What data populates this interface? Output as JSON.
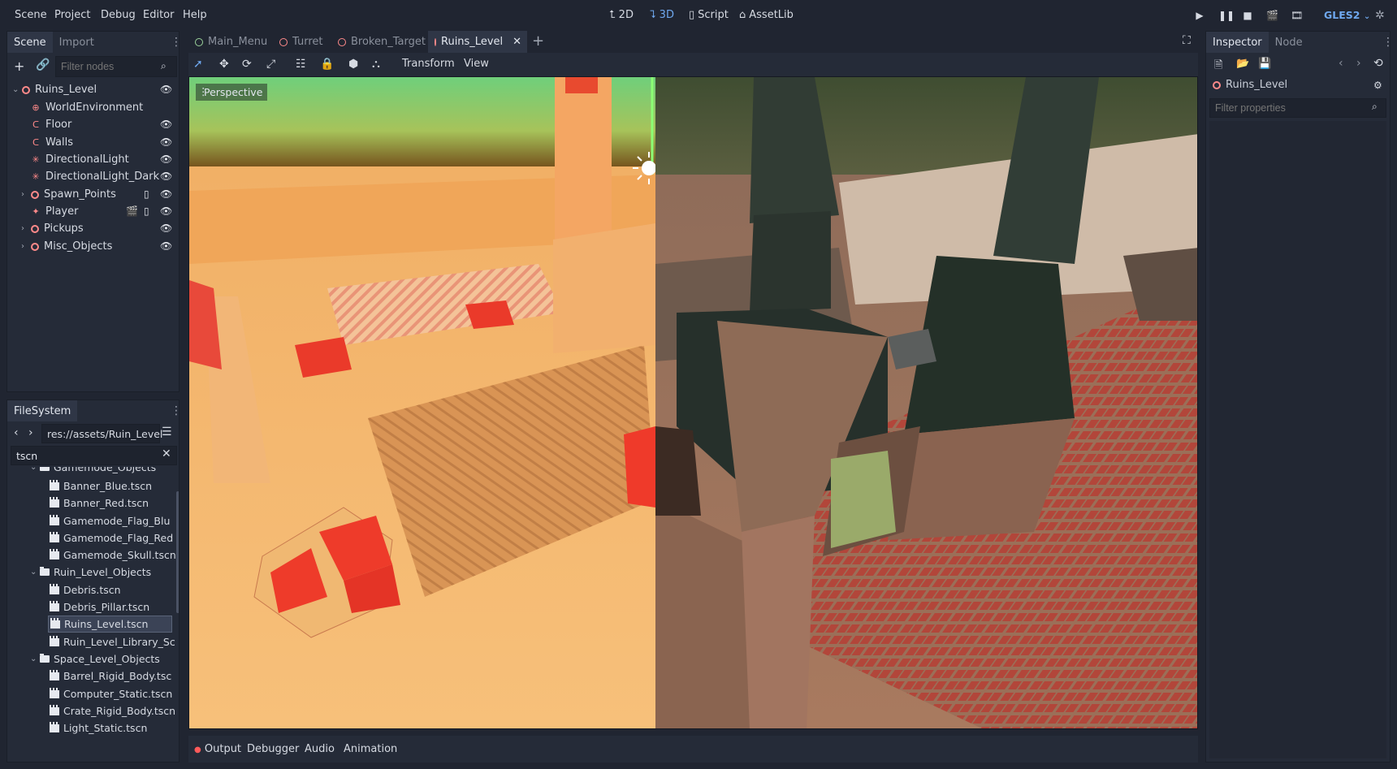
{
  "menu": [
    "Scene",
    "Project",
    "Debug",
    "Editor",
    "Help"
  ],
  "modes": {
    "2d": "2D",
    "3d": "3D",
    "script": "Script",
    "assetlib": "AssetLib"
  },
  "renderer": "GLES2",
  "left_top_panel": {
    "tabs": [
      "Scene",
      "Import"
    ],
    "filter_placeholder": "Filter nodes",
    "tree": [
      {
        "label": "Ruins_Level",
        "icon": "ring-icon"
      },
      {
        "label": "WorldEnvironment",
        "icon": "globe-icon"
      },
      {
        "label": "Floor",
        "icon": "magnet-icon"
      },
      {
        "label": "Walls",
        "icon": "magnet-icon"
      },
      {
        "label": "DirectionalLight",
        "icon": "sun-icon"
      },
      {
        "label": "DirectionalLight_Dark",
        "icon": "sun-icon"
      },
      {
        "label": "Spawn_Points",
        "icon": "ring-icon"
      },
      {
        "label": "Player",
        "icon": "character-icon"
      },
      {
        "label": "Pickups",
        "icon": "ring-icon"
      },
      {
        "label": "Misc_Objects",
        "icon": "ring-icon"
      }
    ]
  },
  "filesystem": {
    "tab": "FileSystem",
    "path": "res://assets/Ruin_Level",
    "search_value": "tscn",
    "items": [
      {
        "label": "Gamemode_Objects",
        "kind": "folder"
      },
      {
        "label": "Banner_Blue.tscn",
        "kind": "scene"
      },
      {
        "label": "Banner_Red.tscn",
        "kind": "scene"
      },
      {
        "label": "Gamemode_Flag_Blu",
        "kind": "scene"
      },
      {
        "label": "Gamemode_Flag_Red",
        "kind": "scene"
      },
      {
        "label": "Gamemode_Skull.tscn",
        "kind": "scene"
      },
      {
        "label": "Ruin_Level_Objects",
        "kind": "folder"
      },
      {
        "label": "Debris.tscn",
        "kind": "scene"
      },
      {
        "label": "Debris_Pillar.tscn",
        "kind": "scene"
      },
      {
        "label": "Ruins_Level.tscn",
        "kind": "scene"
      },
      {
        "label": "Ruin_Level_Library_Sc",
        "kind": "scene"
      },
      {
        "label": "Space_Level_Objects",
        "kind": "folder"
      },
      {
        "label": "Barrel_Rigid_Body.tsc",
        "kind": "scene"
      },
      {
        "label": "Computer_Static.tscn",
        "kind": "scene"
      },
      {
        "label": "Crate_Rigid_Body.tscn",
        "kind": "scene"
      },
      {
        "label": "Light_Static.tscn",
        "kind": "scene"
      }
    ]
  },
  "scene_tabs": [
    "Main_Menu",
    "Turret",
    "Broken_Target",
    "Ruins_Level"
  ],
  "viewport_toolbar": {
    "transform": "Transform",
    "view": "View"
  },
  "viewport_label": "Perspective",
  "bottom_tabs": [
    "Output",
    "Debugger",
    "Audio",
    "Animation"
  ],
  "inspector": {
    "tabs": [
      "Inspector",
      "Node"
    ],
    "object_name": "Ruins_Level",
    "filter_placeholder": "Filter properties"
  },
  "colors": {
    "accent": "#6fa8ef",
    "node_ring": "#ff8a8a",
    "background": "#202531",
    "panel": "#252b38"
  }
}
